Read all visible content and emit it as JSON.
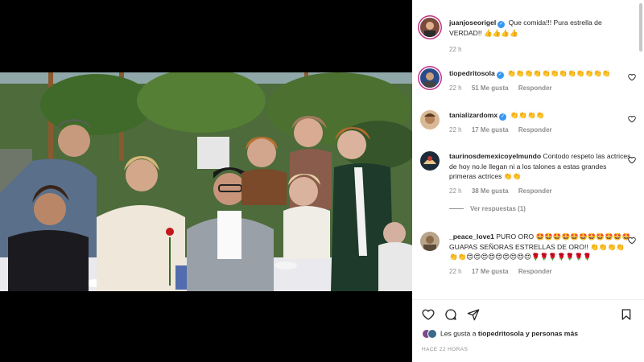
{
  "post": {
    "comments": [
      {
        "username": "juanjoseorigel",
        "verified": true,
        "text": "Que comida!!! Pura estrella de VERDAD!! 👍👍👍👍",
        "time": "22 h",
        "likes": "",
        "reply_label": ""
      },
      {
        "username": "tiopedritosola",
        "verified": true,
        "text": "👏👏👏👏👏👏👏👏👏👏👏👏",
        "time": "22 h",
        "likes": "51 Me gusta",
        "reply_label": "Responder"
      },
      {
        "username": "tanializardomx",
        "verified": true,
        "text": "👏👏👏👏",
        "time": "22 h",
        "likes": "17 Me gusta",
        "reply_label": "Responder"
      },
      {
        "username": "taurinosdemexicoyelmundo",
        "verified": false,
        "text": "Contodo respeto las actrices de hoy no.le llegan ni a los talones a estas grandes primeras actrices 👏👏",
        "time": "22 h",
        "likes": "38 Me gusta",
        "reply_label": "Responder",
        "view_replies": "Ver respuestas (1)"
      },
      {
        "username": "_peace_love1",
        "verified": false,
        "text": "PURO ORO 🤩🤩🤩🤩🤩🤩🤩🤩🤩🤩🤩 GUAPAS SEÑORAS ESTRELLAS DE ORO!! 👏👏👏👏👏👏😍😍😍😍😍😍😍😍😍🌹🌹🌹🌹🌹🌹🌹",
        "time": "22 h",
        "likes": "17 Me gusta",
        "reply_label": "Responder"
      }
    ],
    "likes_summary": {
      "prefix": "Les gusta a",
      "user": "tiopedritosola",
      "suffix": "y personas más"
    },
    "date": "HACE 22 HORAS",
    "icons": [
      "heart-icon",
      "comment-icon",
      "share-icon",
      "bookmark-icon",
      "verified-badge-icon"
    ],
    "colors": {
      "verified": "#3897f0",
      "secondary_text": "#8e8e8e",
      "primary_text": "#262626",
      "story_ring": "#c13584"
    }
  }
}
